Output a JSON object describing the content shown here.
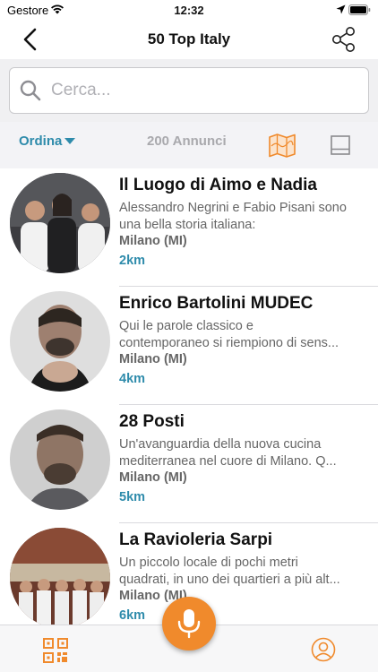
{
  "status_bar": {
    "carrier": "Gestore",
    "time": "12:32"
  },
  "header": {
    "title": "50 Top Italy"
  },
  "search": {
    "placeholder": "Cerca..."
  },
  "filter": {
    "sort_label": "Ordina",
    "count_label": "200 Annunci"
  },
  "colors": {
    "accent_teal": "#2e8bab",
    "accent_orange": "#f08a2c"
  },
  "listings": [
    {
      "name": "Il Luogo di Aimo e Nadia",
      "desc_line1": "Alessandro Negrini e Fabio Pisani sono",
      "desc_line2": "una bella storia italiana:",
      "city": "Milano (MI)",
      "distance": "2km"
    },
    {
      "name": "Enrico Bartolini MUDEC",
      "desc_line1": "Qui le parole classico e",
      "desc_line2": "contemporaneo si riempiono di sens...",
      "city": "Milano (MI)",
      "distance": "4km"
    },
    {
      "name": "28 Posti",
      "desc_line1": "Un'avanguardia della nuova cucina",
      "desc_line2": "mediterranea nel cuore di Milano. Q...",
      "city": "Milano (MI)",
      "distance": "5km"
    },
    {
      "name": "La Ravioleria Sarpi",
      "desc_line1": "Un piccolo locale di pochi metri",
      "desc_line2": "quadrati, in uno dei quartieri a più alt...",
      "city": "Milano (MI)",
      "distance": "6km"
    }
  ],
  "icons": {
    "back": "chevron-left-icon",
    "share": "share-icon",
    "search": "search-icon",
    "map": "map-icon",
    "list": "list-view-icon",
    "mic": "microphone-icon",
    "qr": "qr-code-icon",
    "profile": "profile-icon"
  }
}
